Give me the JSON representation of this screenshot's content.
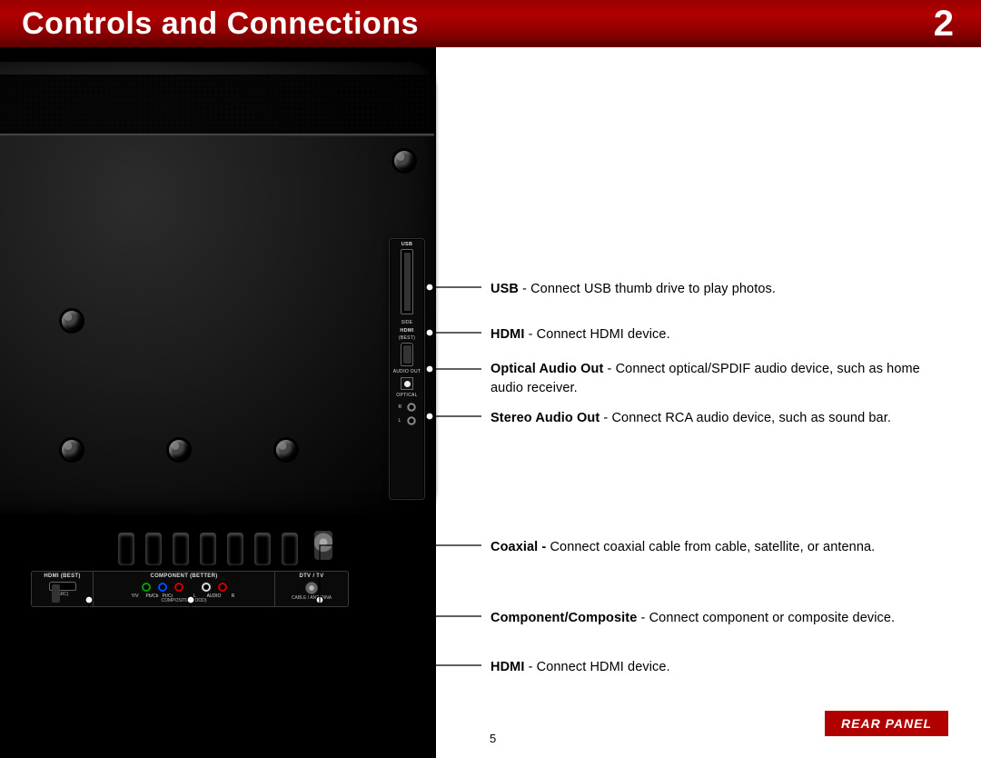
{
  "header": {
    "title": "Controls and Connections",
    "chapter_number": "2"
  },
  "side_ports": {
    "usb_label": "USB",
    "side_label": "SIDE",
    "hdmi_label": "HDMI",
    "hdmi_best_label": "(BEST)",
    "audio_out_label": "AUDIO OUT",
    "optical_label": "OPTICAL",
    "r_label": "R",
    "l_label": "L"
  },
  "bottom_ports": {
    "hdmi_title": "HDMI (BEST)",
    "hdmi_sub": "(ARC)",
    "component_title": "COMPONENT (BETTER)",
    "y_label": "Y/V",
    "pb_label": "Pb/Cb",
    "pr_label": "Pr/Cr",
    "audio_l": "L",
    "audio_word": "AUDIO",
    "audio_r": "R",
    "composite_sub": "COMPOSITE (GOOD)",
    "dtv_title": "DTV / TV",
    "dtv_sub": "CABLE / ANTENNA"
  },
  "callouts": {
    "usb": {
      "bold": "USB",
      "rest": " - Connect USB thumb drive to play photos."
    },
    "hdmi_side": {
      "bold": "HDMI",
      "rest": " - Connect HDMI device."
    },
    "optical": {
      "bold": "Optical Audio Out",
      "rest": " - Connect optical/SPDIF audio device, such as home audio receiver."
    },
    "stereo": {
      "bold": "Stereo Audio Out",
      "rest": " - Connect RCA audio device, such as sound bar."
    },
    "coaxial": {
      "bold": "Coaxial - ",
      "rest": "Connect coaxial cable from cable, satellite, or antenna."
    },
    "component": {
      "bold": "Component/Composite",
      "rest": " - Connect component or composite device."
    },
    "hdmi_bottom": {
      "bold": "HDMI",
      "rest": " - Connect HDMI device."
    }
  },
  "footer": {
    "badge": "REAR PANEL",
    "page_number": "5"
  },
  "colors": {
    "header_red": "#a10000",
    "badge_red": "#b00000"
  }
}
